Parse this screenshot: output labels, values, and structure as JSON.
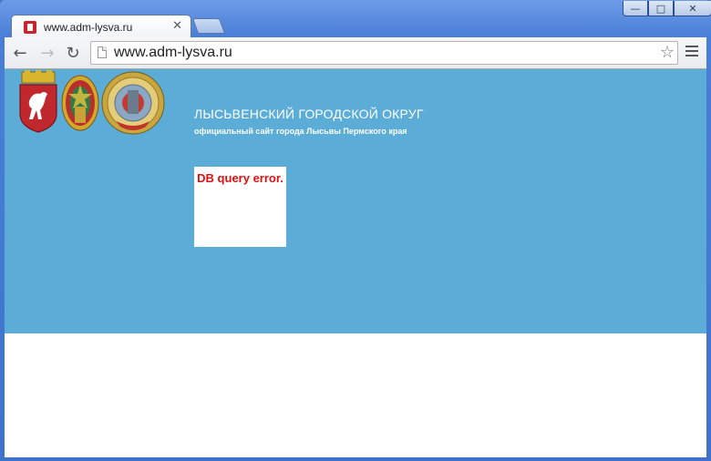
{
  "browser": {
    "tab_title": "www.adm-lysva.ru",
    "url": "www.adm-lysva.ru",
    "window_controls": [
      "minimize-icon",
      "maximize-icon",
      "close-icon"
    ]
  },
  "site": {
    "title": "ЛЫСЬВЕНСКИЙ ГОРОДСКОЙ ОКРУГ",
    "subtitle": "официальный сайт города Лысьвы Пермского края",
    "error_message": "DB query error.",
    "colors": {
      "banner": "#5bacd6",
      "error_text": "#dd1111"
    }
  }
}
